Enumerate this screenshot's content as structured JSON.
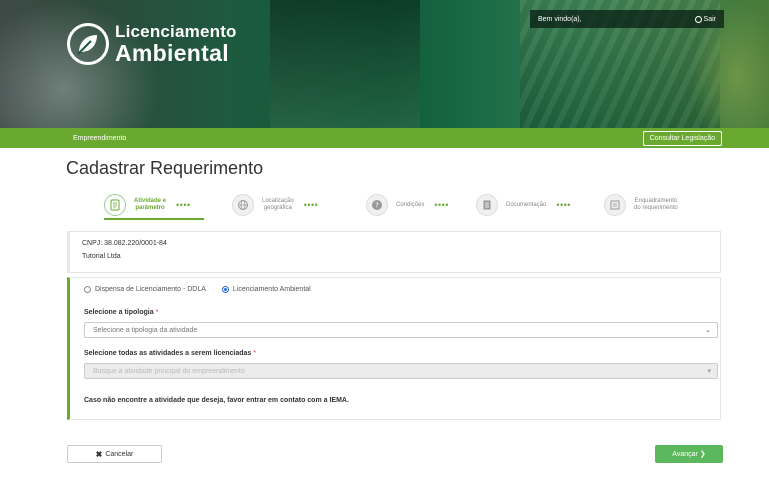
{
  "header": {
    "logo_line1": "Licenciamento",
    "logo_line2": "Ambiental",
    "welcome": "Bem vindo(a),",
    "logout": "Sair"
  },
  "navbar": {
    "section": "Empreendimento",
    "legislation_button": "Consultar Legislação"
  },
  "page": {
    "title": "Cadastrar Requerimento"
  },
  "stepper": {
    "steps": [
      {
        "label_line1": "Atividade e",
        "label_line2": "parâmetro",
        "active": true,
        "icon": "document-icon"
      },
      {
        "label_line1": "Localização",
        "label_line2": "geográfica",
        "active": false,
        "icon": "globe-icon"
      },
      {
        "label_line1": "Condições",
        "label_line2": "",
        "active": false,
        "icon": "question-icon"
      },
      {
        "label_line1": "Documentação",
        "label_line2": "",
        "active": false,
        "icon": "file-icon"
      },
      {
        "label_line1": "Enquadramento",
        "label_line2": "do requerimento",
        "active": false,
        "icon": "checklist-icon"
      }
    ],
    "dots": "••••"
  },
  "company": {
    "cnpj": "CNPJ: 38.082.220/0001-84",
    "name": "Tutorial Ltda"
  },
  "form": {
    "radio_options": [
      {
        "label": "Dispensa de Licenciamento - DDLA",
        "checked": false
      },
      {
        "label": "Licenciamento Ambiental",
        "checked": true
      }
    ],
    "tipologia_label": "Selecione a tipologia",
    "tipologia_placeholder": "Selecione a tipologia da atividade",
    "atividades_label": "Selecione todas as atividades a serem licenciadas",
    "atividades_placeholder": "Busque a atividade principal do empreendimento",
    "required_mark": "*",
    "notice": "Caso não encontre a atividade que deseja, favor entrar em contato com a IEMA."
  },
  "actions": {
    "cancel": "Cancelar",
    "next": "Avançar"
  },
  "colors": {
    "brand_green": "#6aa930",
    "next_button": "#5cb85c",
    "radio_blue": "#2a6bd6"
  }
}
